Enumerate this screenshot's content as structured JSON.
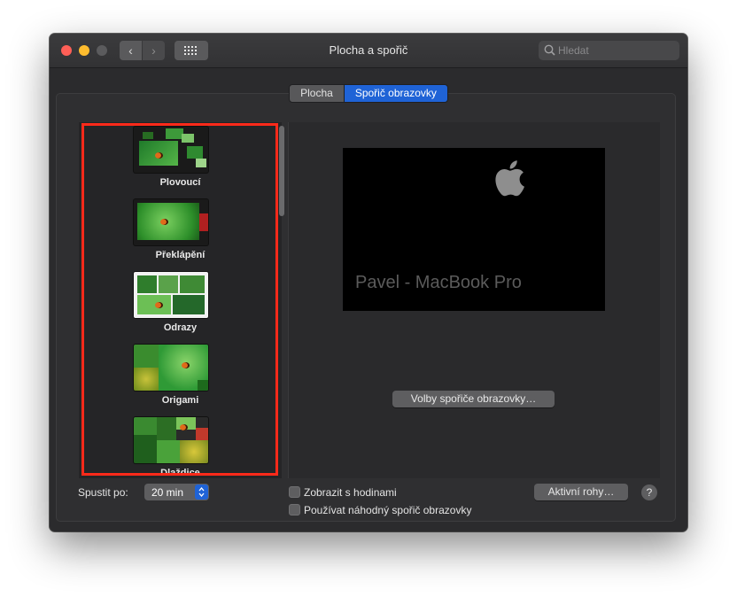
{
  "window": {
    "title": "Plocha a spořič",
    "search_placeholder": "Hledat"
  },
  "tabs": [
    {
      "label": "Plocha",
      "active": false
    },
    {
      "label": "Spořič obrazovky",
      "active": true
    }
  ],
  "screensavers": [
    {
      "label": "Plovoucí"
    },
    {
      "label": "Překlápění"
    },
    {
      "label": "Odrazy"
    },
    {
      "label": "Origami"
    },
    {
      "label": "Dlaždice"
    }
  ],
  "preview": {
    "text": "Pavel - MacBook Pro"
  },
  "options_button": "Volby spořiče obrazovky…",
  "start_after": {
    "label": "Spustit po:",
    "value": "20 min"
  },
  "checkboxes": [
    {
      "label": "Zobrazit s hodinami",
      "checked": false
    },
    {
      "label": "Používat náhodný spořič obrazovky",
      "checked": false
    }
  ],
  "hot_corners_button": "Aktivní rohy…",
  "help_button": "?",
  "colors": {
    "accent": "#1f63d6",
    "highlight_box": "#ff2a1a",
    "window_bg": "#2b2b2d"
  },
  "icons": {
    "back": "chevron-left-icon",
    "forward": "chevron-right-icon",
    "grid": "grid-icon",
    "search": "search-icon",
    "apple": "apple-logo-icon"
  }
}
